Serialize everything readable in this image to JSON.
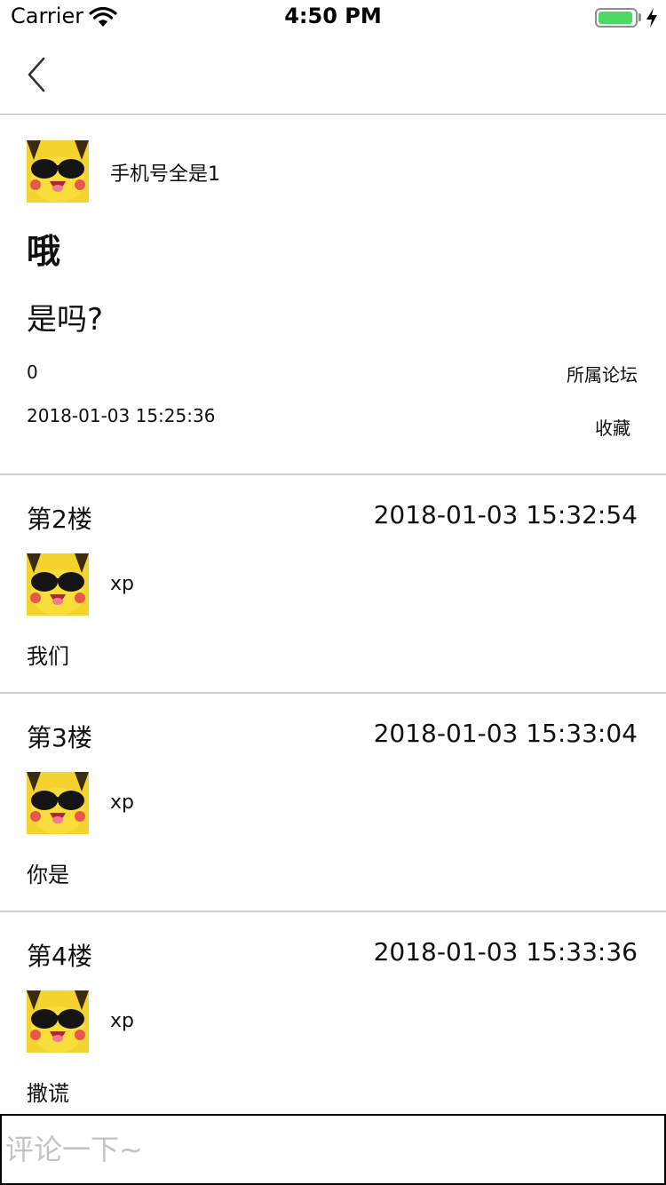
{
  "status_bar": {
    "carrier": "Carrier",
    "time": "4:50 PM",
    "battery_level": 0.95,
    "wifi_icon": "wifi-icon",
    "charging_icon": "bolt-icon"
  },
  "nav": {
    "back_icon": "chevron-left-icon"
  },
  "post": {
    "author": "手机号全是1",
    "title": "哦",
    "content": "是吗?",
    "count": "0",
    "forum_label": "所属论坛",
    "time": "2018-01-03 15:25:36",
    "favorite_label": "收藏"
  },
  "replies": [
    {
      "floor": "第2楼",
      "time": "2018-01-03 15:32:54",
      "author": "xp",
      "text": "我们"
    },
    {
      "floor": "第3楼",
      "time": "2018-01-03 15:33:04",
      "author": "xp",
      "text": "你是"
    },
    {
      "floor": "第4楼",
      "time": "2018-01-03 15:33:36",
      "author": "xp",
      "text": "撒谎"
    }
  ],
  "comment": {
    "placeholder": "评论一下~",
    "value": ""
  },
  "colors": {
    "battery_green": "#4cd964",
    "avatar_yellow": "#f7d930",
    "divider": "#cfcfcf",
    "placeholder": "#c4c4c4"
  }
}
